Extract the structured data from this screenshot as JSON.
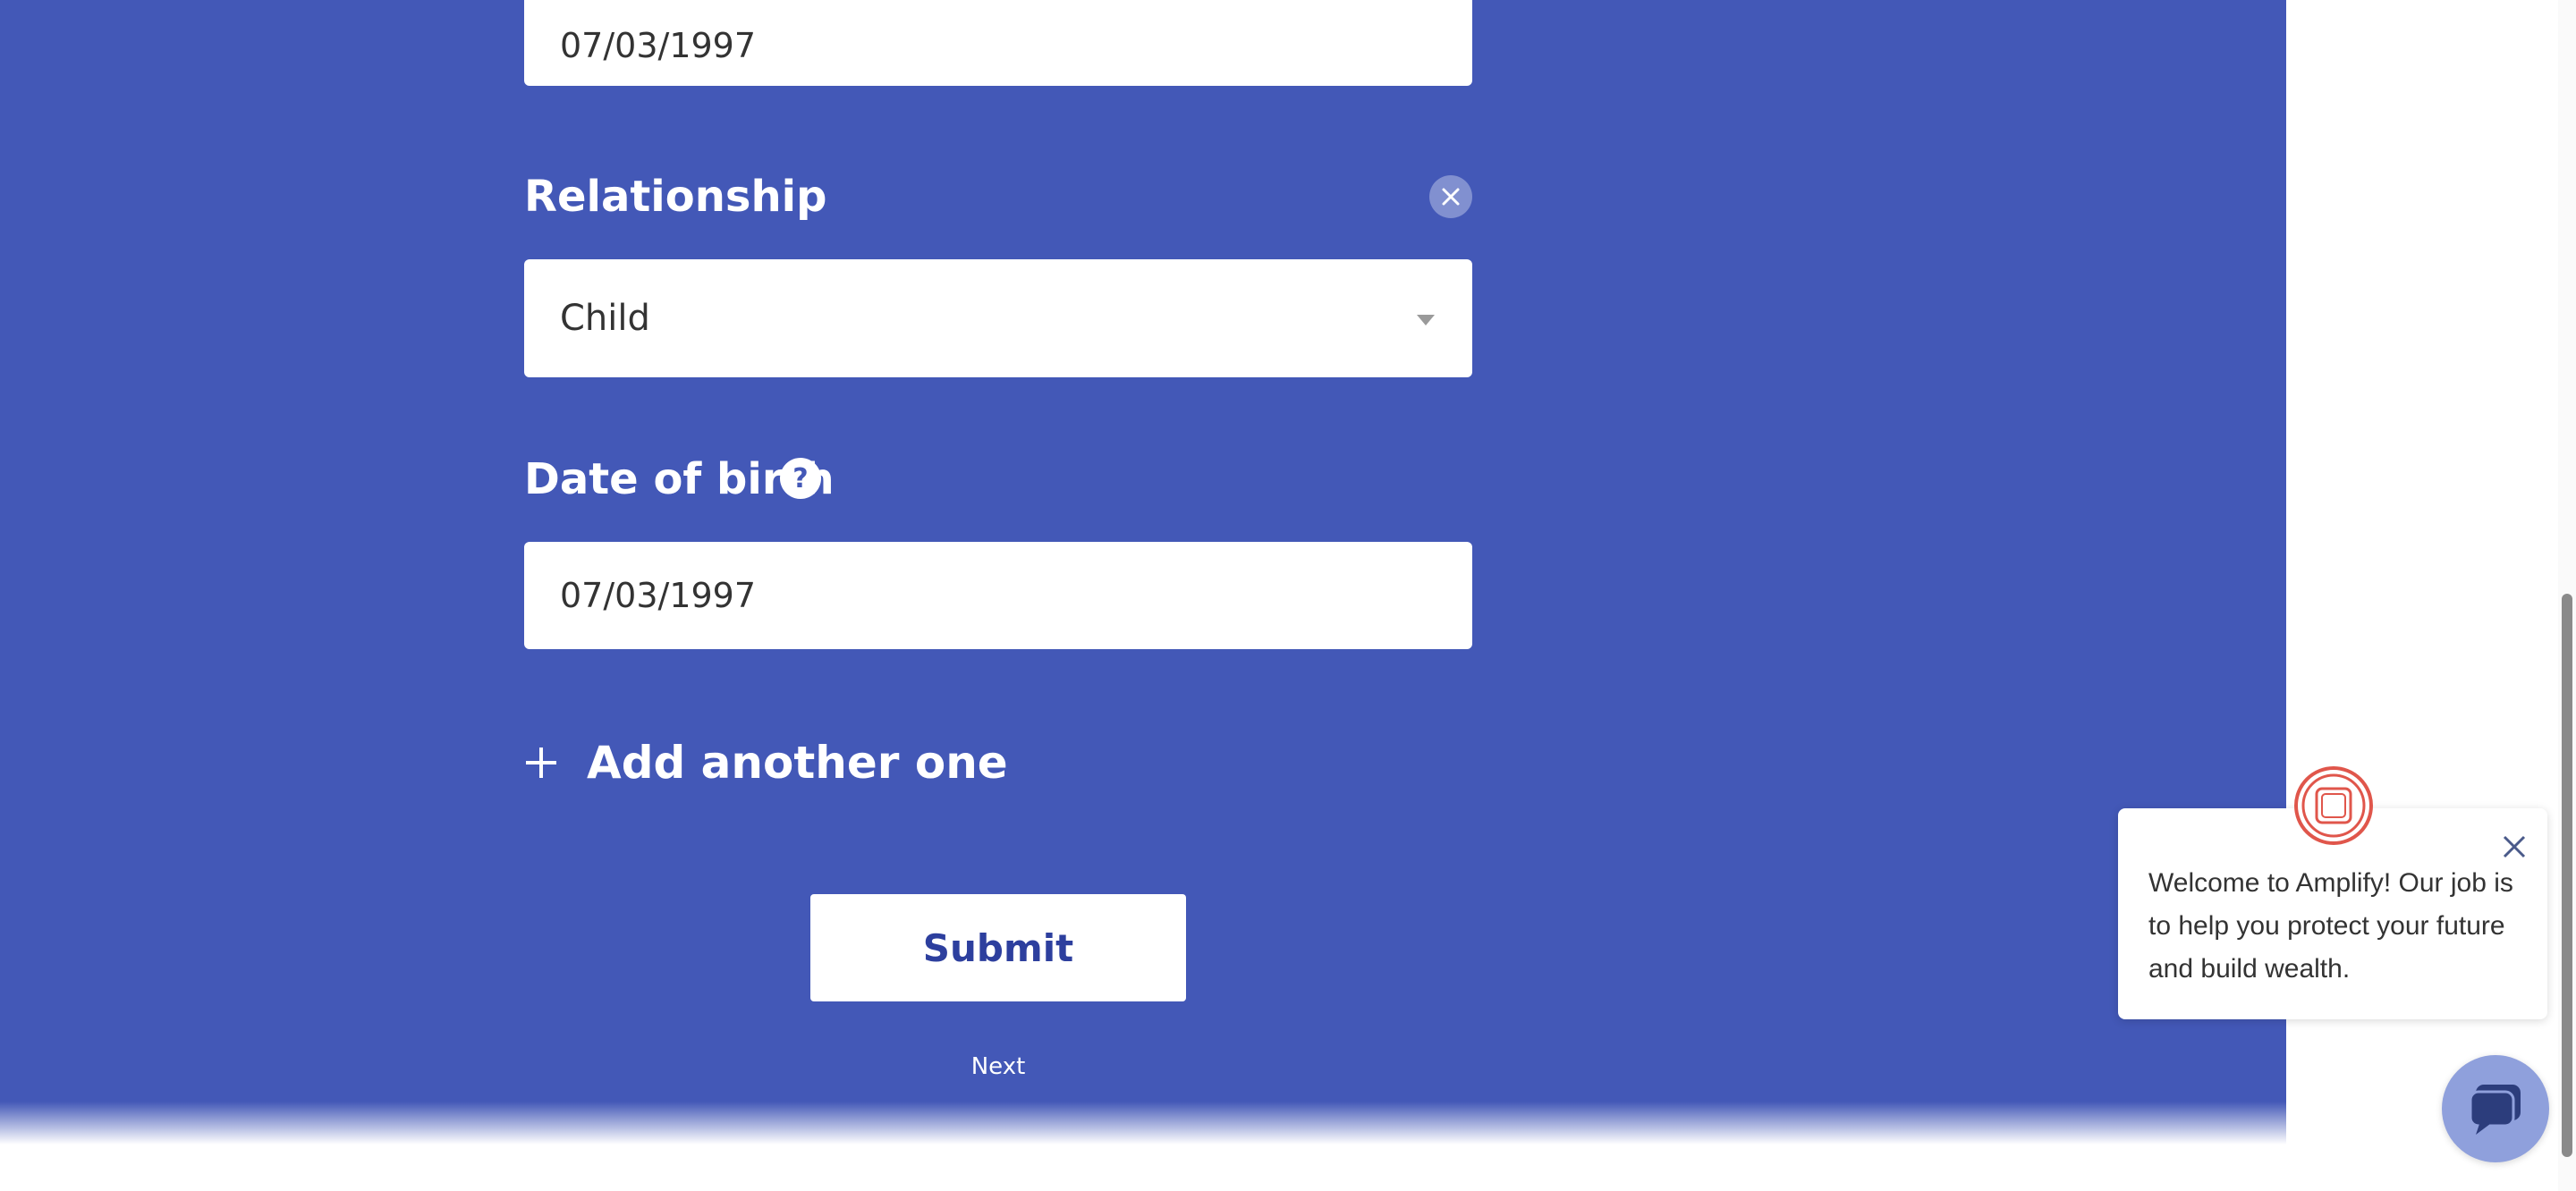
{
  "form": {
    "top_field_value": "07/03/1997",
    "relationship": {
      "label": "Relationship",
      "selected": "Child"
    },
    "date_of_birth": {
      "label": "Date of birth",
      "value": "07/03/1997",
      "help_icon": "?"
    },
    "add_another_label": "Add another one",
    "submit_label": "Submit",
    "next_label": "Next"
  },
  "chat": {
    "message": "Welcome to Amplify! Our job is to help you protect your future and build wealth."
  },
  "colors": {
    "panel": "#4358b7",
    "submit_text": "#2d3f9e",
    "logo": "#e0564b"
  }
}
